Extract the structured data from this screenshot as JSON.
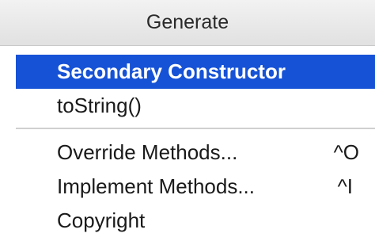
{
  "popup": {
    "title": "Generate",
    "items": [
      {
        "label": "Secondary Constructor",
        "shortcut": "",
        "selected": true
      },
      {
        "label": "toString()",
        "shortcut": "",
        "selected": false
      },
      {
        "label": "Override Methods...",
        "shortcut": "^O",
        "selected": false
      },
      {
        "label": "Implement Methods...",
        "shortcut": "^I",
        "selected": false
      },
      {
        "label": "Copyright",
        "shortcut": "",
        "selected": false
      }
    ]
  },
  "colors": {
    "selection": "#1652d6",
    "header_bg": "#e8e8e8",
    "separator": "#d0d0d0"
  }
}
